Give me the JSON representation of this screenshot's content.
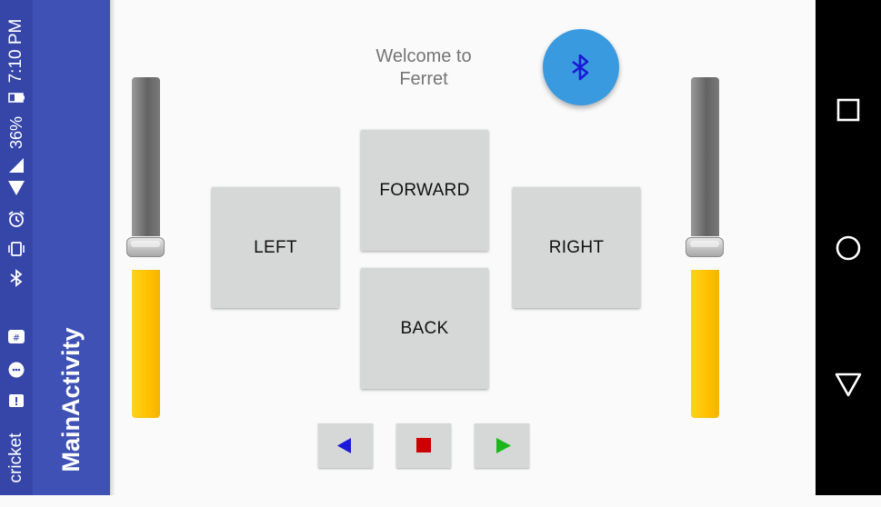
{
  "status_bar": {
    "time": "7:10 PM",
    "battery_percent": "36%",
    "carrier": "cricket",
    "icons": [
      "battery-icon",
      "signal-icon",
      "wifi-icon",
      "alarm-icon",
      "vibrate-icon",
      "bluetooth-icon",
      "hangouts-icon",
      "messenger-icon",
      "message-icon"
    ]
  },
  "action_bar": {
    "title": "MainActivity"
  },
  "main": {
    "welcome": "Welcome to Ferret",
    "bluetooth_icon": "bluetooth-icon",
    "buttons": {
      "forward": "FORWARD",
      "left": "LEFT",
      "right": "RIGHT",
      "back": "BACK"
    },
    "media": [
      {
        "icon": "previous-triangle-icon",
        "color": "#1a1ad6"
      },
      {
        "icon": "stop-square-icon",
        "color": "#cc0000"
      },
      {
        "icon": "play-triangle-icon",
        "color": "#1bb81b"
      }
    ],
    "sliders": {
      "left_value": 0.5,
      "right_value": 0.5,
      "track_top_color": "#6f6f6f",
      "track_bottom_color": "#ffc107"
    }
  },
  "nav_bar": {
    "icons": [
      "recents-square-icon",
      "home-circle-icon",
      "back-triangle-icon"
    ]
  },
  "colors": {
    "status_bar": "#3646a8",
    "action_bar": "#3f51b5",
    "fab": "#3a9ae0",
    "button": "#d6d7d7"
  }
}
